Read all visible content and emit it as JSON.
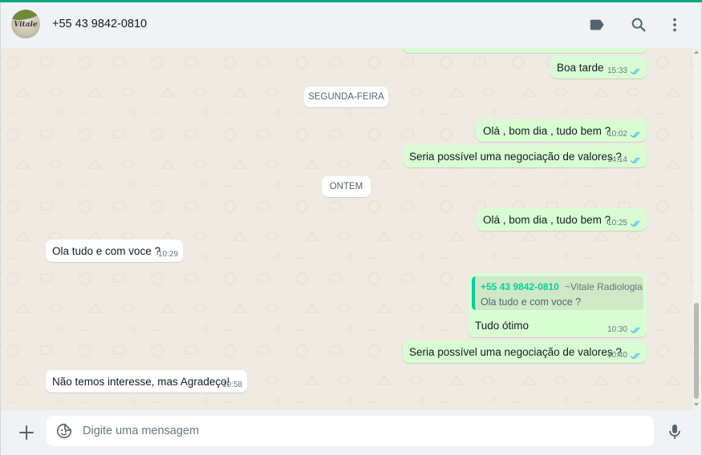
{
  "header": {
    "avatar_logo_text": "Vitale",
    "contact_name": "+55 43 9842-0810",
    "icons": [
      "label-icon",
      "search-icon",
      "menu-icon"
    ]
  },
  "messages": [
    {
      "type": "out",
      "text": "Boa  tarde",
      "time": "15:33",
      "status": "read"
    },
    {
      "type": "divider",
      "text": "SEGUNDA-FEIRA"
    },
    {
      "type": "out",
      "text": "Olá , bom dia , tudo bem ?",
      "time": "10:02",
      "status": "read"
    },
    {
      "type": "out",
      "text": "Seria possível uma negociação de valores ?",
      "time": "14:14",
      "status": "read"
    },
    {
      "type": "divider",
      "text": "ONTEM"
    },
    {
      "type": "out",
      "text": "Olá , bom dia , tudo bem ?",
      "time": "10:25",
      "status": "read"
    },
    {
      "type": "in",
      "text": "Ola tudo e com voce ?",
      "time": "10:29"
    },
    {
      "type": "out",
      "quote": {
        "phone": "+55 43 9842-0810",
        "name": "~Vitale Radiologia",
        "text": "Ola tudo e com voce ?"
      },
      "text": "Tudo ótimo",
      "time": "10:30",
      "status": "read"
    },
    {
      "type": "out",
      "text": "Seria possível uma negociação de valores ?",
      "time": "10:40",
      "status": "read"
    },
    {
      "type": "in",
      "text": "Não temos interesse, mas Agradeço!",
      "time": "10:58"
    }
  ],
  "footer": {
    "placeholder": "Digite uma mensagem",
    "icons": [
      "plus-icon",
      "sticker-emoji-icon",
      "microphone-icon"
    ]
  },
  "colors": {
    "accent": "#00a884",
    "outgoing_bubble": "#d9fdd3",
    "incoming_bubble": "#ffffff",
    "read_ticks": "#53bdeb",
    "chat_background": "#efeae2"
  }
}
